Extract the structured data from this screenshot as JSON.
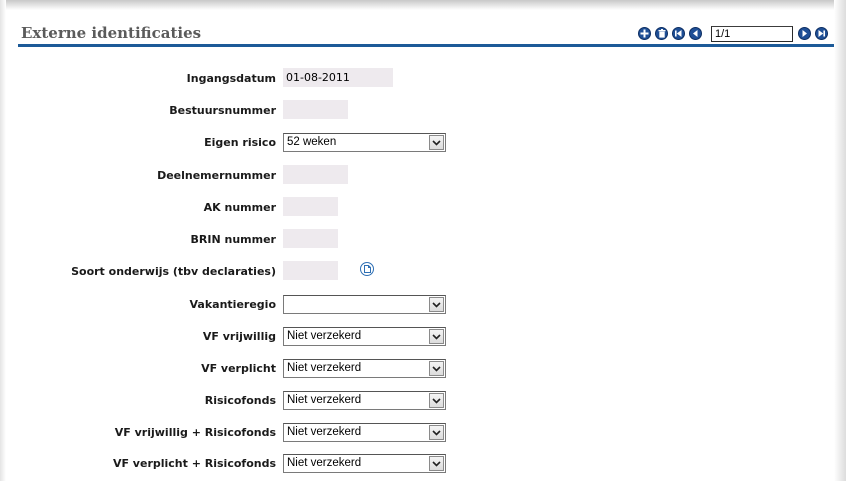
{
  "header": {
    "title": "Externe identificaties"
  },
  "pager": {
    "value": "1/1"
  },
  "icons": {
    "add": "plus-circle-icon",
    "delete": "trash-circle-icon",
    "first": "first-record-icon",
    "prev": "previous-record-icon",
    "next": "next-record-icon",
    "last": "last-record-icon",
    "lookup": "document-circle-icon"
  },
  "colors": {
    "accent": "#1c5a98",
    "field_bg": "#eeeaee",
    "button": "#1f4f96"
  },
  "form": {
    "ingangsdatum": {
      "label": "Ingangsdatum",
      "value": "01-08-2011"
    },
    "bestuursnummer": {
      "label": "Bestuursnummer",
      "value": ""
    },
    "eigen_risico": {
      "label": "Eigen risico",
      "value": "52 weken"
    },
    "deelnemernummer": {
      "label": "Deelnemernummer",
      "value": ""
    },
    "ak_nummer": {
      "label": "AK nummer",
      "value": ""
    },
    "brin_nummer": {
      "label": "BRIN nummer",
      "value": ""
    },
    "soort_onderwijs": {
      "label": "Soort onderwijs (tbv declaraties)",
      "value": ""
    },
    "vakantieregio": {
      "label": "Vakantieregio",
      "value": ""
    },
    "vf_vrijwillig": {
      "label": "VF vrijwillig",
      "value": "Niet verzekerd"
    },
    "vf_verplicht": {
      "label": "VF verplicht",
      "value": "Niet verzekerd"
    },
    "risicofonds": {
      "label": "Risicofonds",
      "value": "Niet verzekerd"
    },
    "vf_vrijwillig_risicofonds": {
      "label": "VF vrijwillig + Risicofonds",
      "value": "Niet verzekerd"
    },
    "vf_verplicht_risicofonds": {
      "label": "VF verplicht + Risicofonds",
      "value": "Niet verzekerd"
    }
  }
}
